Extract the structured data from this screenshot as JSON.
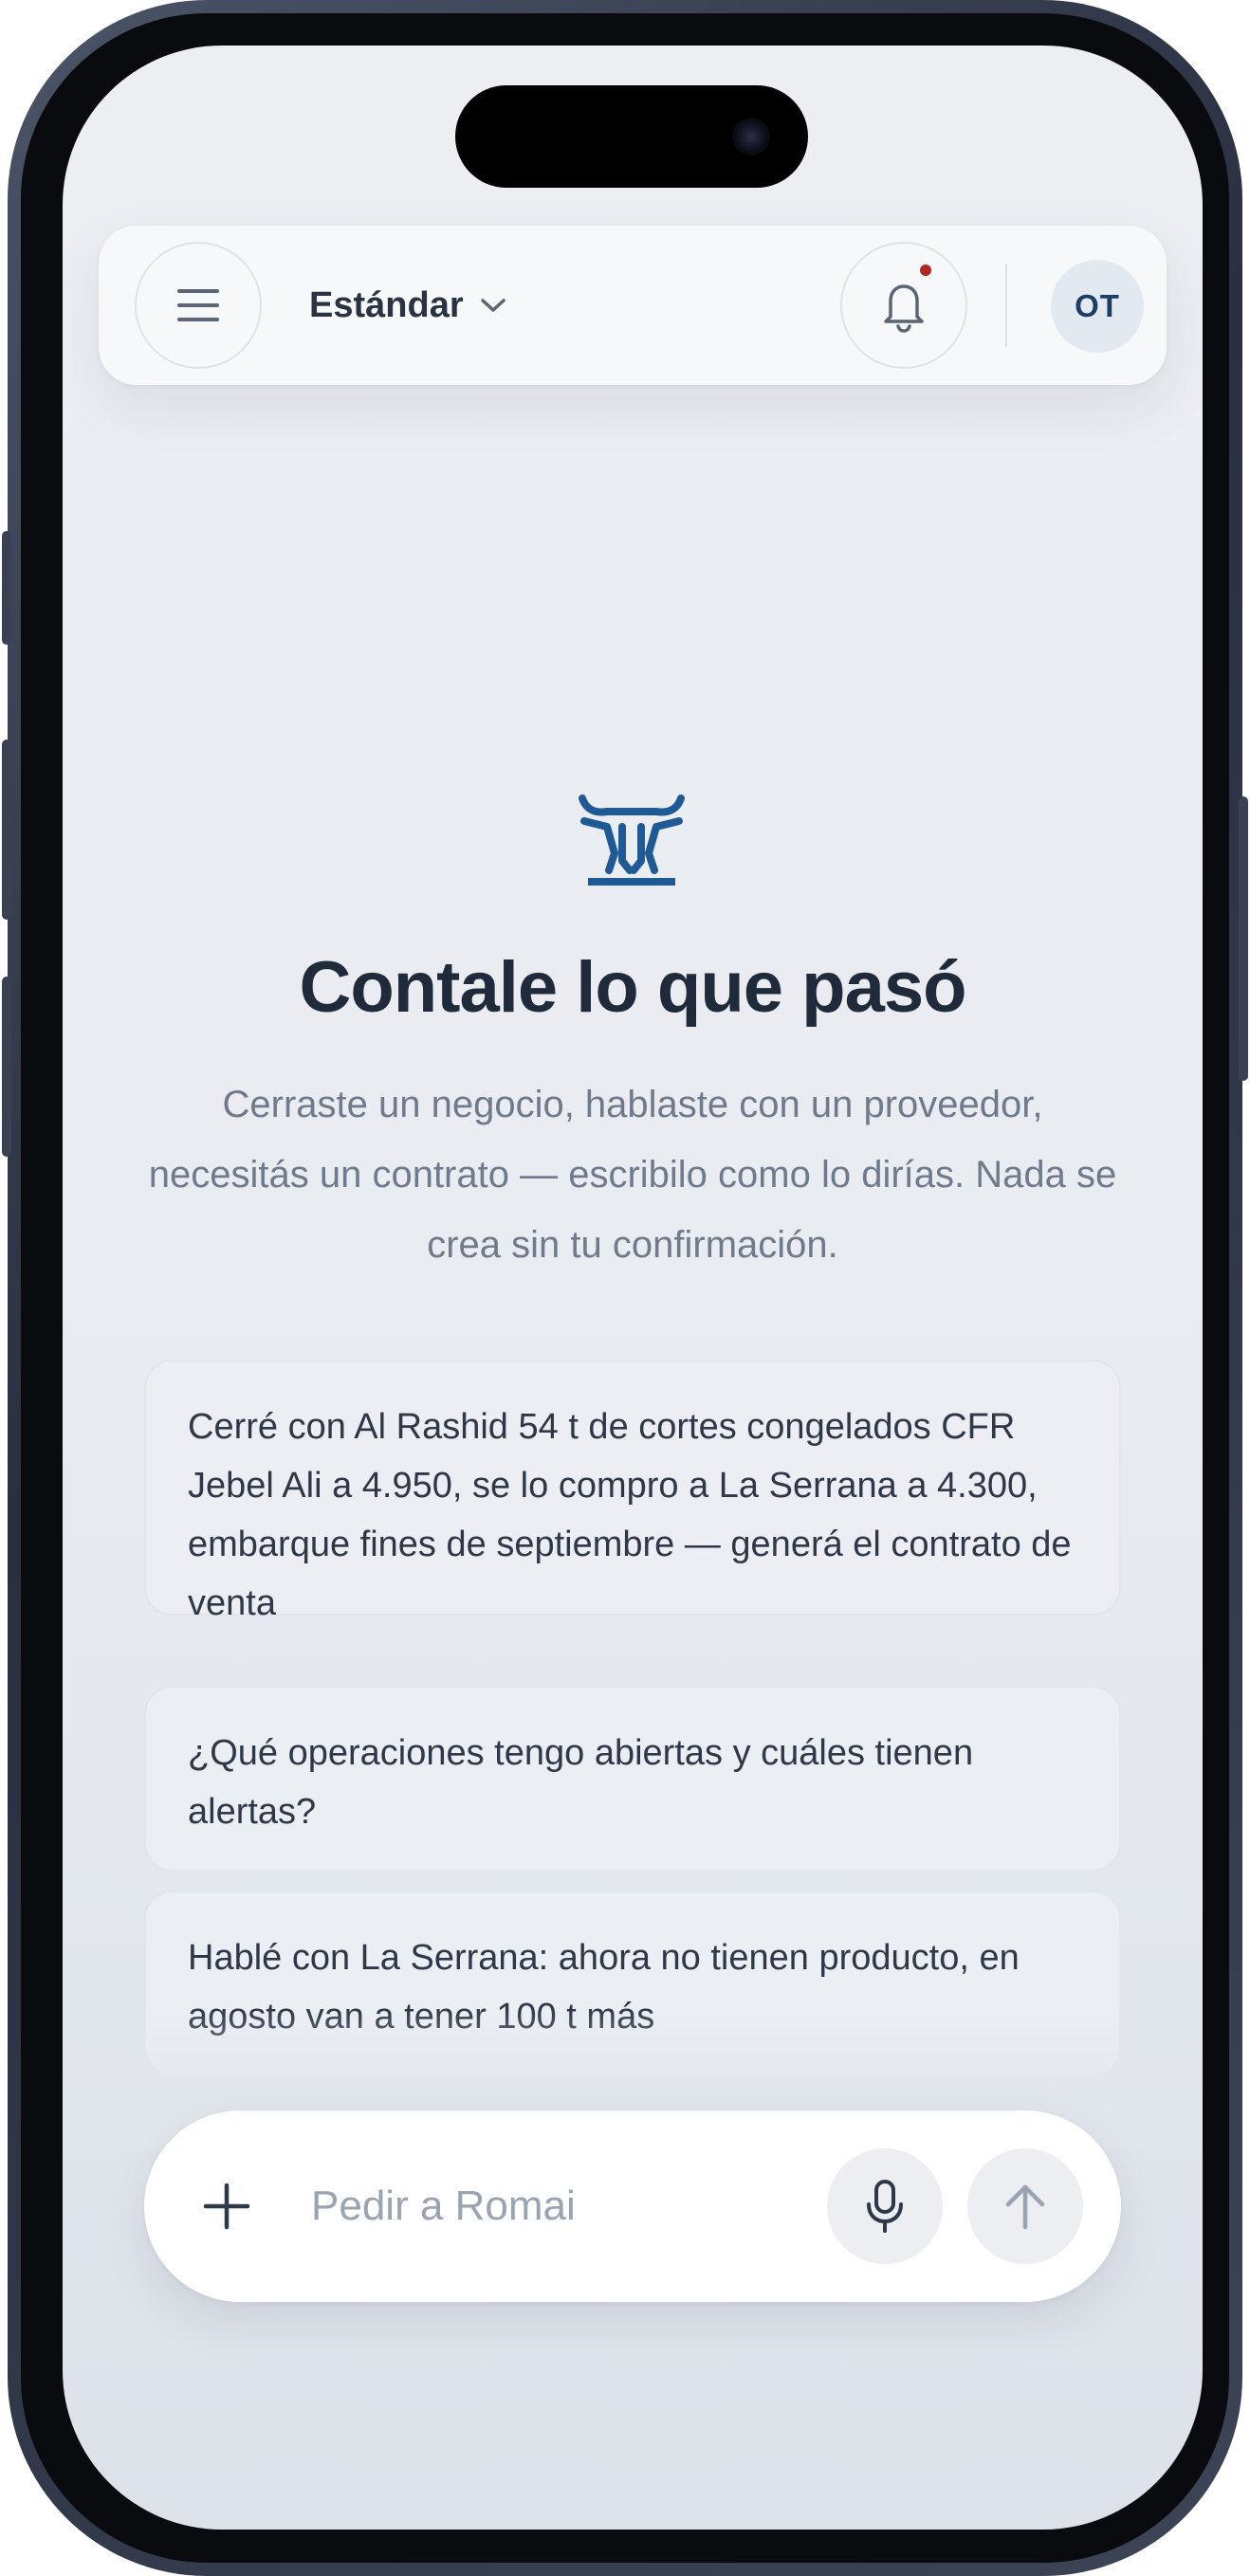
{
  "header": {
    "menu_icon": "hamburger-icon",
    "mode_label": "Estándar",
    "notifications_icon": "bell-icon",
    "has_unread": true,
    "avatar_initials": "OT"
  },
  "hero": {
    "logo_icon": "bull-head-icon",
    "title": "Contale lo que pasó",
    "subtitle": "Cerraste un negocio, hablaste con un proveedor, necesitás un contrato — escribilo como lo dirías. Nada se crea sin tu confirmación."
  },
  "suggestions": [
    "Cerré con Al Rashid 54 t de cortes congelados CFR Jebel Ali a 4.950, se lo compro a La Serrana a 4.300, embarque fines de septiembre — generá el contrato de venta",
    "¿Qué operaciones tengo abiertas y cuáles tienen alertas?",
    "Hablé con La Serrana: ahora no tienen producto, en agosto van a tener 100 t más"
  ],
  "composer": {
    "placeholder": "Pedir a Romai",
    "value": "",
    "add_icon": "plus-icon",
    "mic_icon": "microphone-icon",
    "send_icon": "arrow-up-icon"
  },
  "colors": {
    "accent": "#1f5a94",
    "text_primary": "#1f2a3a",
    "text_muted": "#6f7a8c",
    "alert_dot": "#b3261e"
  }
}
